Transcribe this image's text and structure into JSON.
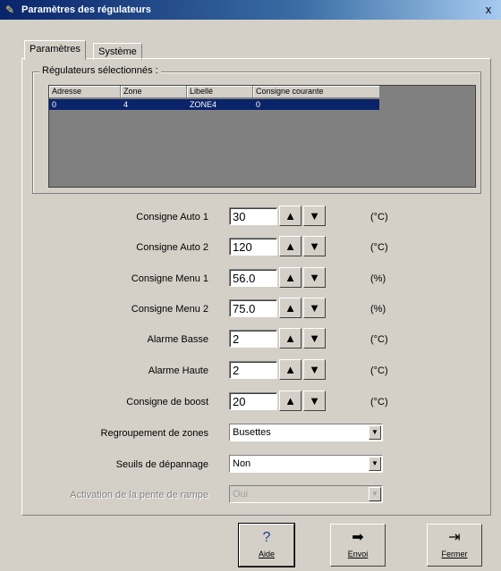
{
  "window": {
    "title": "Paramètres des régulateurs",
    "close_label": "x"
  },
  "tabs": [
    {
      "label": "Paramètres"
    },
    {
      "label": "Système"
    }
  ],
  "group": {
    "label": "Régulateurs sélectionnés :",
    "columns": [
      "Adresse",
      "Zone",
      "Libellé",
      "Consigne courante"
    ],
    "rows": [
      [
        "0",
        "4",
        "ZONE4",
        "0"
      ]
    ]
  },
  "fields": [
    {
      "label": "Consigne Auto 1",
      "value": "30",
      "unit": "(°C)"
    },
    {
      "label": "Consigne Auto 2",
      "value": "120",
      "unit": "(°C)"
    },
    {
      "label": "Consigne Menu 1",
      "value": "56.0",
      "unit": "(%)"
    },
    {
      "label": "Consigne Menu 2",
      "value": "75.0",
      "unit": "(%)"
    },
    {
      "label": "Alarme Basse",
      "value": "2",
      "unit": "(°C)"
    },
    {
      "label": "Alarme Haute",
      "value": "2",
      "unit": "(°C)"
    },
    {
      "label": "Consigne de boost",
      "value": "20",
      "unit": "(°C)"
    }
  ],
  "selects": [
    {
      "label": "Regroupement de zones",
      "value": "Busettes"
    },
    {
      "label": "Seuils de dépannage",
      "value": "Non"
    },
    {
      "label": "Activation de la pente de rampe",
      "value": "Oui"
    }
  ],
  "buttons": {
    "aide": {
      "label": "Aide",
      "icon": "?"
    },
    "envoi": {
      "label": "Envoi",
      "icon": "➡"
    },
    "fermer": {
      "label": "Fermer",
      "icon": "⇥"
    }
  },
  "icons": {
    "up_arrow": "▲",
    "down_arrow": "▼",
    "dropdown_arrow": "▼"
  }
}
